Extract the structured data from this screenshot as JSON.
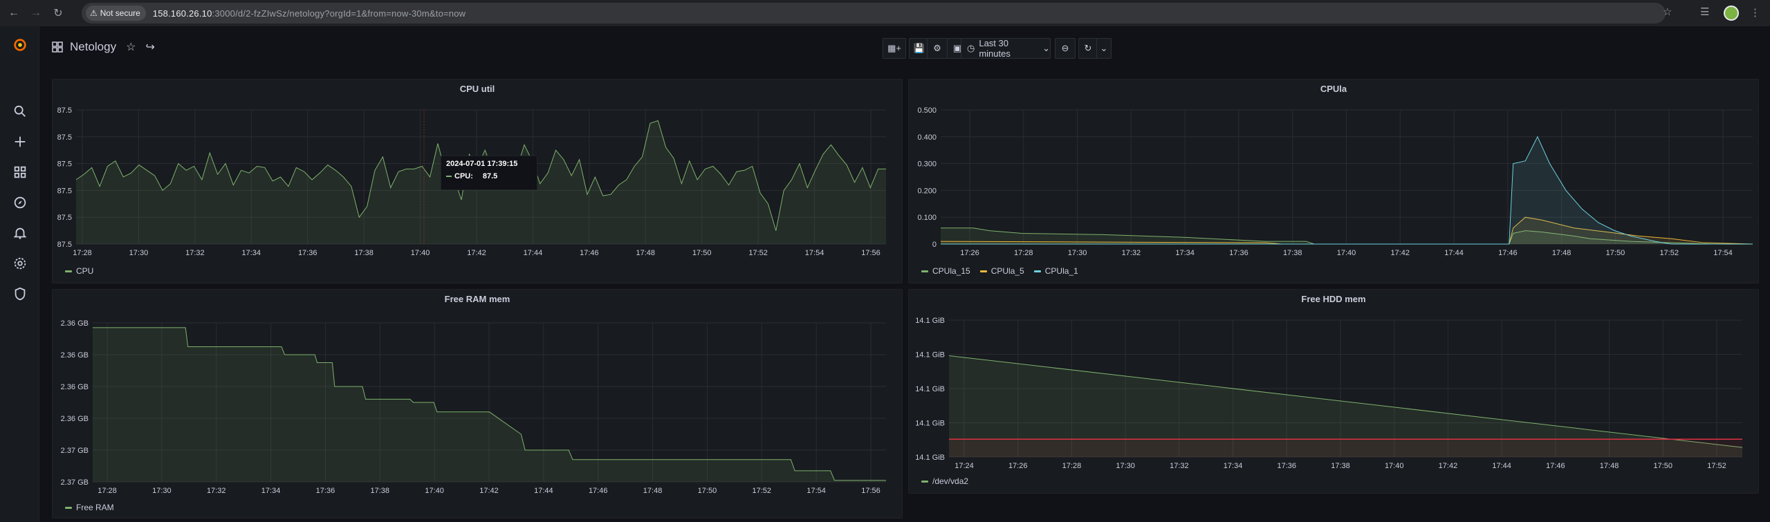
{
  "browser": {
    "security_label": "Not secure",
    "url_host": "158.160.26.10",
    "url_rest": ":3000/d/2-fzZIwSz/netology?orgId=1&from=now-30m&to=now"
  },
  "sidebar": {
    "items": [
      "search-icon",
      "plus-icon",
      "dashboards-icon",
      "explore-icon",
      "alerting-icon",
      "settings-icon",
      "shield-icon"
    ]
  },
  "topbar": {
    "dashboard_title": "Netology",
    "time_range_label": "Last 30 minutes"
  },
  "colors": {
    "series_green": "#7eb26d",
    "series_yellow": "#eab839",
    "series_blue": "#6ed0e0",
    "threshold_red": "#e02f44"
  },
  "panels": {
    "cpu_util": {
      "title": "CPU util",
      "legend": [
        "CPU"
      ]
    },
    "cpula": {
      "title": "CPUla",
      "legend": [
        "CPUla_15",
        "CPUla_5",
        "CPUla_1"
      ]
    },
    "free_ram": {
      "title": "Free RAM mem",
      "legend": [
        "Free RAM"
      ]
    },
    "free_hdd": {
      "title": "Free HDD mem",
      "legend": [
        "/dev/vda2"
      ]
    }
  },
  "tooltip": {
    "time": "2024-07-01 17:39:15",
    "series": "CPU:",
    "value": "87.5"
  },
  "chart_data": [
    {
      "type": "line",
      "title": "CPU util",
      "x_ticks": [
        "17:28",
        "17:30",
        "17:32",
        "17:34",
        "17:36",
        "17:38",
        "17:40",
        "17:42",
        "17:44",
        "17:46",
        "17:48",
        "17:50",
        "17:52",
        "17:54",
        "17:56"
      ],
      "y_ticks": [
        "87.5",
        "87.5",
        "87.5",
        "87.5",
        "87.5",
        "87.5"
      ],
      "series": [
        {
          "name": "CPU",
          "color": "#7eb26d",
          "values": [
            48,
            52,
            57,
            43,
            58,
            62,
            50,
            53,
            59,
            55,
            51,
            40,
            45,
            60,
            55,
            58,
            48,
            68,
            52,
            60,
            44,
            55,
            53,
            58,
            57,
            47,
            50,
            43,
            57,
            54,
            48,
            53,
            59,
            55,
            50,
            43,
            20,
            28,
            55,
            65,
            42,
            54,
            56,
            56,
            58,
            50,
            75,
            53,
            50,
            33,
            67,
            57,
            70,
            55,
            60,
            43,
            55,
            74,
            62,
            45,
            53,
            70,
            63,
            51,
            63,
            37,
            50,
            36,
            37,
            44,
            48,
            58,
            65,
            90,
            92,
            72,
            64,
            45,
            62,
            48,
            56,
            58,
            52,
            44,
            54,
            55,
            58,
            38,
            30,
            10,
            40,
            48,
            60,
            42,
            55,
            67,
            74,
            66,
            59,
            46,
            57,
            42,
            56,
            56
          ]
        }
      ],
      "annotation_time": "17:39:15"
    },
    {
      "type": "line",
      "title": "CPUla",
      "x_ticks": [
        "17:26",
        "17:28",
        "17:30",
        "17:32",
        "17:34",
        "17:36",
        "17:38",
        "17:40",
        "17:42",
        "17:44",
        "17:46",
        "17:48",
        "17:50",
        "17:52",
        "17:54"
      ],
      "y_ticks": [
        "0",
        "0.100",
        "0.200",
        "0.300",
        "0.400",
        "0.500"
      ],
      "ylim": [
        0,
        0.5
      ],
      "series": [
        {
          "name": "CPUla_15",
          "color": "#7eb26d"
        },
        {
          "name": "CPUla_5",
          "color": "#eab839"
        },
        {
          "name": "CPUla_1",
          "color": "#6ed0e0"
        }
      ]
    },
    {
      "type": "line",
      "title": "Free RAM mem",
      "x_ticks": [
        "17:28",
        "17:30",
        "17:32",
        "17:34",
        "17:36",
        "17:38",
        "17:40",
        "17:42",
        "17:44",
        "17:46",
        "17:48",
        "17:50",
        "17:52",
        "17:54",
        "17:56"
      ],
      "y_ticks": [
        "2.37 GB",
        "2.37 GB",
        "2.36 GB",
        "2.36 GB",
        "2.36 GB",
        "2.36 GB"
      ],
      "series": [
        {
          "name": "Free RAM",
          "color": "#7eb26d"
        }
      ]
    },
    {
      "type": "line",
      "title": "Free HDD mem",
      "x_ticks": [
        "17:24",
        "17:26",
        "17:28",
        "17:30",
        "17:32",
        "17:34",
        "17:36",
        "17:38",
        "17:40",
        "17:42",
        "17:44",
        "17:46",
        "17:48",
        "17:50",
        "17:52"
      ],
      "y_ticks": [
        "14.1 GiB",
        "14.1 GiB",
        "14.1 GiB",
        "14.1 GiB",
        "14.1 GiB"
      ],
      "series": [
        {
          "name": "/dev/vda2",
          "color": "#7eb26d"
        }
      ],
      "threshold_color": "#e02f44"
    }
  ]
}
